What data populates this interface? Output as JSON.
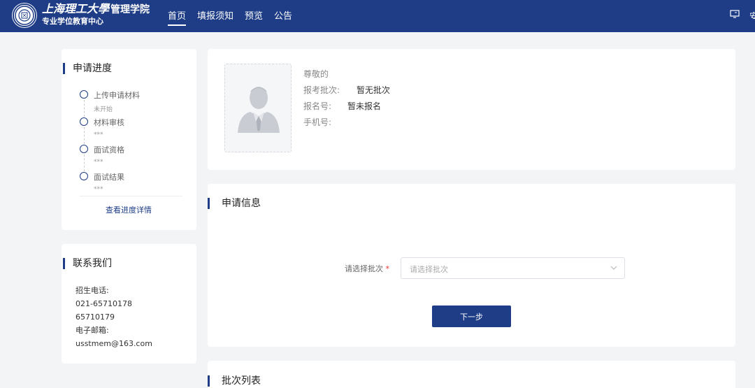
{
  "header": {
    "brand_script": "上海理工大學",
    "brand_school": "管理学院",
    "brand_center": "专业学位教育中心",
    "nav": [
      {
        "label": "首页",
        "active": true
      },
      {
        "label": "填报须知",
        "active": false
      },
      {
        "label": "预览",
        "active": false
      },
      {
        "label": "公告",
        "active": false
      }
    ],
    "right_icon": "screen-icon",
    "right_clip_text": "安"
  },
  "progress": {
    "title": "申请进度",
    "steps": [
      {
        "label": "上传申请材料",
        "status": "未开始"
      },
      {
        "label": "材料审核",
        "status": "***"
      },
      {
        "label": "面试资格",
        "status": "***"
      },
      {
        "label": "面试结果",
        "status": "***"
      }
    ],
    "detail_link": "查看进度详情"
  },
  "contact": {
    "title": "联系我们",
    "lines": [
      "招生电话:",
      "021-65710178",
      "65710179",
      "电子邮箱:",
      "usstmem@163.com"
    ]
  },
  "profile": {
    "greeting": "尊敬的",
    "batch_label": "报考批次:",
    "batch_value": "暂无批次",
    "regno_label": "报名号:",
    "regno_value": "暂未报名",
    "phone_label": "手机号:",
    "phone_value": ""
  },
  "apply": {
    "title": "申请信息",
    "select_label": "请选择批次",
    "required_mark": "*",
    "select_placeholder": "请选择批次",
    "next_button": "下一步"
  },
  "batch_list": {
    "title": "批次列表"
  },
  "colors": {
    "brand": "#1e3d86",
    "background": "#f3f4f6",
    "required": "#ee3333"
  }
}
